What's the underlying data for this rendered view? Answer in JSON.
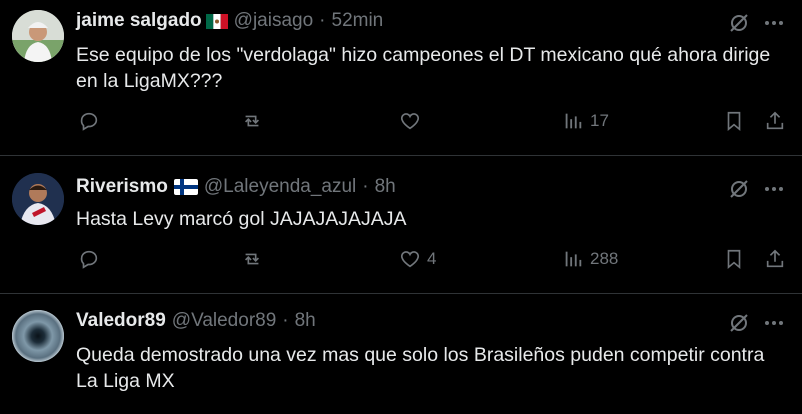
{
  "tweets": [
    {
      "name": "jaime salgado",
      "handle": "@jaisago",
      "sep": "·",
      "time": "52min",
      "text": "Ese equipo de  los \"verdolaga\" hizo campeones el DT mexicano qué ahora dirige en la LigaMX???",
      "likes": "",
      "views": "17",
      "flag": "mexico-flag-icon"
    },
    {
      "name": "Riverismo",
      "handle": "@Laleyenda_azul",
      "sep": "·",
      "time": "8h",
      "text": "Hasta Levy marcó gol JAJAJAJAJAJA",
      "likes": "4",
      "views": "288",
      "flag": "finland-flag-icon"
    },
    {
      "name": "Valedor89",
      "handle": "@Valedor89",
      "sep": "·",
      "time": "8h",
      "text": "Queda demostrado una vez mas que solo los Brasileños puden competir contra La Liga MX",
      "likes": "",
      "views": "",
      "flag": ""
    }
  ],
  "colors": {
    "background": "#000000",
    "text": "#e7e9ea",
    "muted": "#71767b",
    "divider": "#2f3336"
  }
}
